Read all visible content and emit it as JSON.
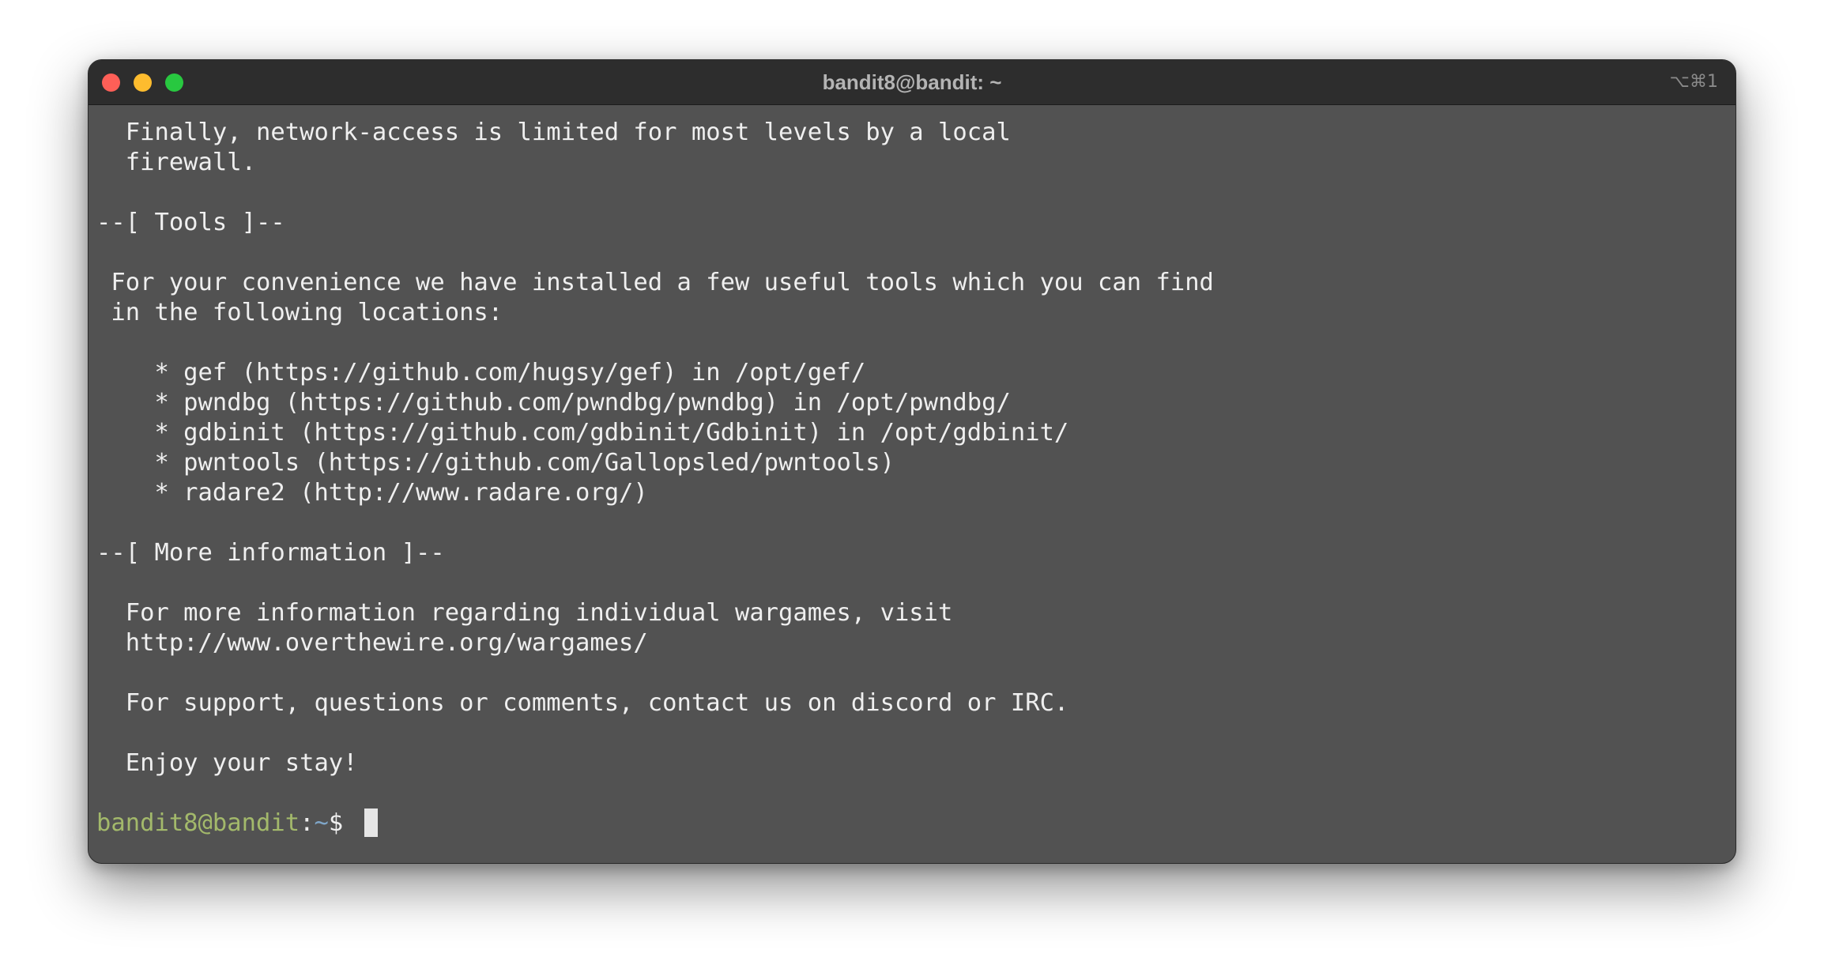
{
  "window": {
    "title": "bandit8@bandit: ~",
    "shortcut": "⌥⌘1",
    "colors": {
      "close": "#fe5f57",
      "minimize": "#febc2e",
      "maximize": "#28c840",
      "background": "#525252",
      "titlebar": "#2d2d2d",
      "prompt_user": "#a3b96b",
      "prompt_dir": "#7fa6c8",
      "cursor": "#e6e6e6"
    }
  },
  "terminal": {
    "lines": [
      "  Finally, network-access is limited for most levels by a local",
      "  firewall.",
      "",
      "--[ Tools ]--",
      "",
      " For your convenience we have installed a few useful tools which you can find",
      " in the following locations:",
      "",
      "    * gef (https://github.com/hugsy/gef) in /opt/gef/",
      "    * pwndbg (https://github.com/pwndbg/pwndbg) in /opt/pwndbg/",
      "    * gdbinit (https://github.com/gdbinit/Gdbinit) in /opt/gdbinit/",
      "    * pwntools (https://github.com/Gallopsled/pwntools)",
      "    * radare2 (http://www.radare.org/)",
      "",
      "--[ More information ]--",
      "",
      "  For more information regarding individual wargames, visit",
      "  http://www.overthewire.org/wargames/",
      "",
      "  For support, questions or comments, contact us on discord or IRC.",
      "",
      "  Enjoy your stay!",
      ""
    ],
    "prompt": {
      "user_host": "bandit8@bandit",
      "separator": ":",
      "path": "~",
      "symbol": "$ "
    }
  }
}
